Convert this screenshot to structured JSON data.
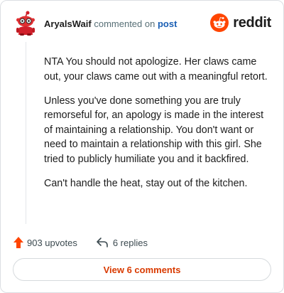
{
  "comment": {
    "username": "AryalsWaif",
    "commented_on_text": "commented on",
    "post_link": "post",
    "paragraphs": [
      "NTA You should not apologize. Her claws came out, your claws came out with a meaningful retort.",
      "Unless you've done something you are truly remorseful for, an apology is made in the interest of maintaining a relationship. You don't want or need to maintain a relationship with this girl. She tried to publicly humiliate you and it backfired.",
      "Can't handle the heat, stay out of the kitchen."
    ]
  },
  "brand": {
    "name": "reddit",
    "color": "#ff4500"
  },
  "actions": {
    "upvotes": "903 upvotes",
    "replies": "6 replies"
  },
  "view_comments_label": "View 6 comments",
  "colors": {
    "accent": "#d93a00",
    "upvote": "#ff4500",
    "link": "#1a5fb4"
  },
  "icons": [
    "avatar",
    "reddit-logo-icon",
    "upvote-arrow-icon",
    "reply-icon"
  ]
}
